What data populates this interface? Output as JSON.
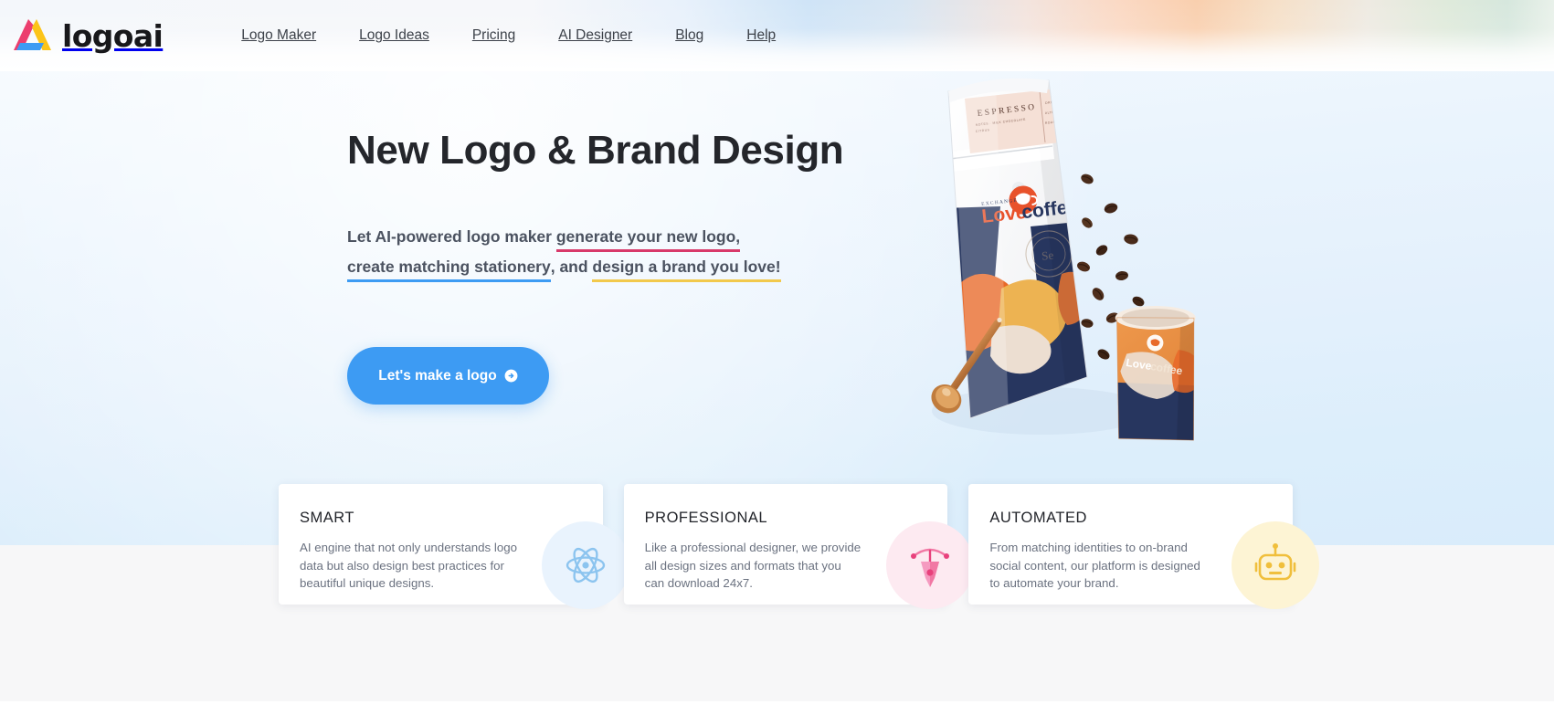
{
  "brand": {
    "name": "logoai",
    "logo_icon": "logoai-triangle-icon",
    "colors": {
      "pink": "#ec3e6e",
      "yellow": "#fcc419",
      "blue": "#3d9bf3"
    }
  },
  "nav": {
    "items": [
      {
        "label": "Logo Maker",
        "name": "nav-link-logo-maker"
      },
      {
        "label": "Logo Ideas",
        "name": "nav-link-logo-ideas"
      },
      {
        "label": "Pricing",
        "name": "nav-link-pricing"
      },
      {
        "label": "AI Designer",
        "name": "nav-link-ai-designer"
      },
      {
        "label": "Blog",
        "name": "nav-link-blog"
      },
      {
        "label": "Help",
        "name": "nav-link-help"
      }
    ]
  },
  "hero": {
    "title": "New Logo & Brand Design",
    "sub_lead": "Let AI-powered logo maker ",
    "sub_link_1": "generate your new logo,",
    "sub_link_2": "create matching stationery",
    "sub_mid": ", and ",
    "sub_link_3": "design a brand you love!",
    "underline_1_color": "#d8396a",
    "underline_2_color": "#3d9bf3",
    "underline_3_color": "#f2c94c",
    "cta_label": "Let's make a logo",
    "cta_icon": "arrow-right-circle-icon",
    "illustration": {
      "name": "coffee-brand-mockup",
      "bag_label_title": "ESPRESSO",
      "bag_brand_top": "EXCHANGE",
      "bag_brand_love": "Love",
      "bag_brand_coffee": "coffee",
      "cup_brand_love": "Love",
      "cup_brand_coffee": "coffee",
      "seal_letter": "Se",
      "items": [
        "coffee-bag",
        "coffee-beans",
        "coffee-cup",
        "coffee-scoop"
      ]
    }
  },
  "cards": [
    {
      "title": "SMART",
      "desc": "AI engine that not only understands logo data but also design best practices for beautiful unique designs.",
      "icon": "atom-icon",
      "icon_style": "ci-blue",
      "icon_color": "#8cc4ef",
      "name": "feature-card-smart"
    },
    {
      "title": "PROFESSIONAL",
      "desc": "Like a professional designer, we provide all design sizes and formats that you can download 24x7.",
      "icon": "pen-nib-icon",
      "icon_style": "ci-pink",
      "icon_color": "#f178a4",
      "name": "feature-card-professional"
    },
    {
      "title": "AUTOMATED",
      "desc": "From matching identities to on-brand social content, our platform is designed to automate your brand.",
      "icon": "robot-icon",
      "icon_style": "ci-yellow",
      "icon_color": "#f2c94c",
      "name": "feature-card-automated"
    }
  ]
}
